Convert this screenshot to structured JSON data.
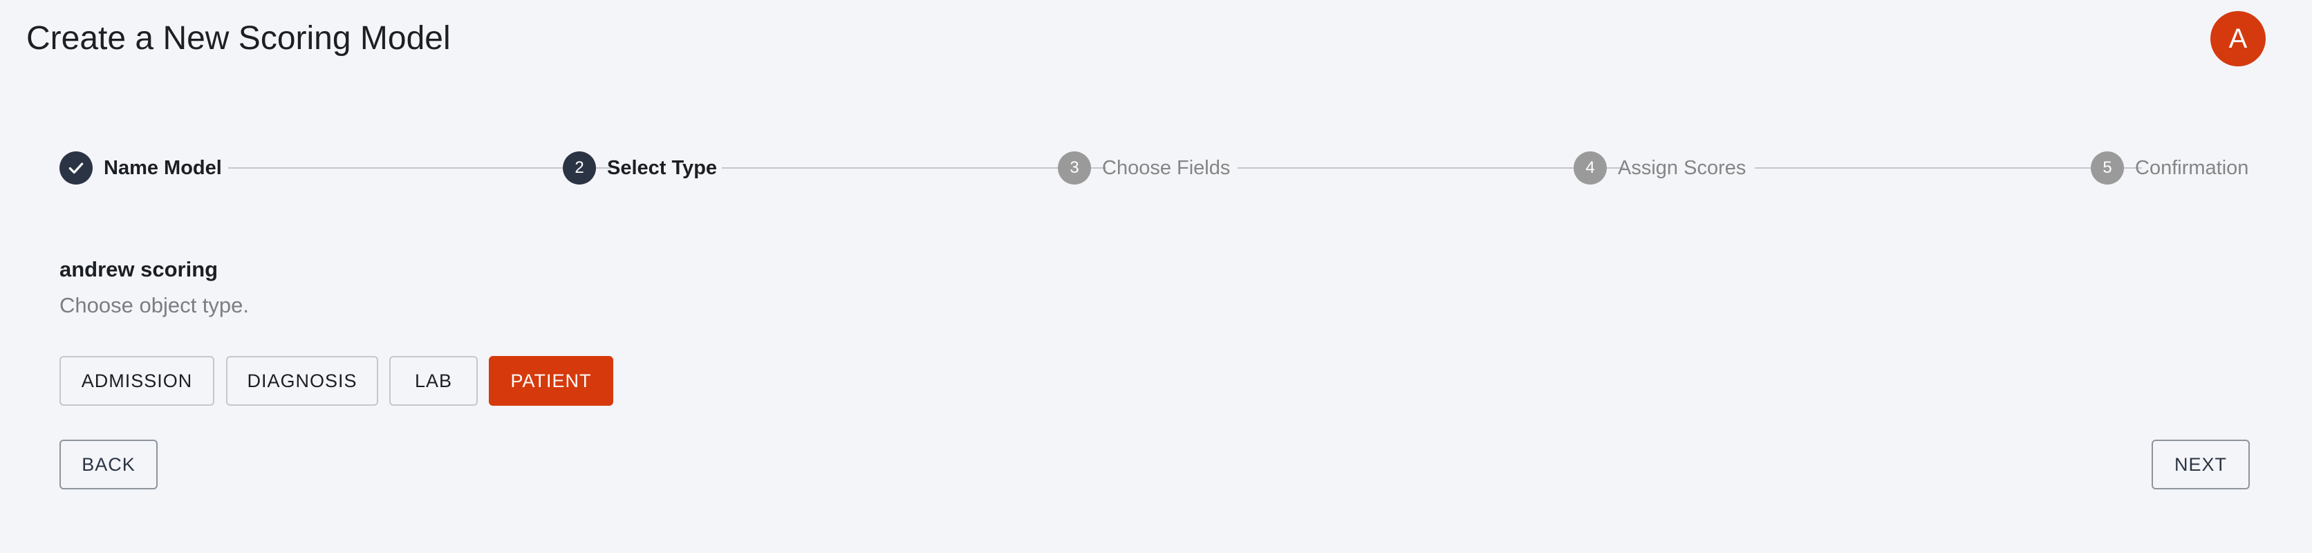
{
  "header": {
    "title": "Create a New Scoring Model",
    "avatar_initial": "A"
  },
  "stepper": {
    "steps": [
      {
        "number": "",
        "label": "Name Model",
        "status": "completed",
        "icon": "check-icon"
      },
      {
        "number": "2",
        "label": "Select Type",
        "status": "active"
      },
      {
        "number": "3",
        "label": "Choose Fields",
        "status": "pending"
      },
      {
        "number": "4",
        "label": "Assign Scores",
        "status": "pending"
      },
      {
        "number": "5",
        "label": "Confirmation",
        "status": "pending"
      }
    ]
  },
  "content": {
    "model_name": "andrew scoring",
    "instruction": "Choose object type."
  },
  "object_types": {
    "options": [
      "ADMISSION",
      "DIAGNOSIS",
      "LAB",
      "PATIENT"
    ],
    "selected": "PATIENT"
  },
  "navigation": {
    "back_label": "BACK",
    "next_label": "NEXT"
  },
  "colors": {
    "accent": "#d63a0c",
    "avatar": "#d43a0e",
    "step_active": "#2b3444",
    "step_pending": "#9a9a9a",
    "background": "#f4f5f9"
  }
}
